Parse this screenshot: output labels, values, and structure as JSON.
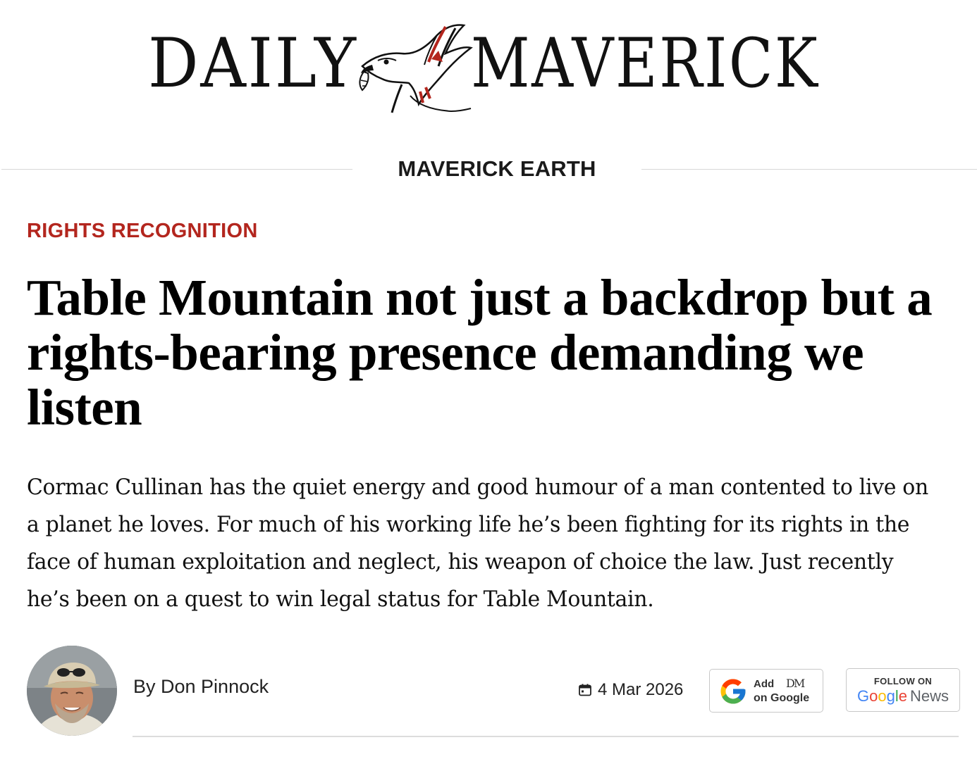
{
  "masthead": {
    "logo_left": "DAILY",
    "logo_right": "MAVERICK",
    "logo_icon": "eagle-icon"
  },
  "section": {
    "label": "MAVERICK EARTH"
  },
  "article": {
    "kicker": "RIGHTS RECOGNITION",
    "headline": "Table Mountain not just a backdrop but a rights-bearing presence demanding we listen",
    "standfirst": "Cormac Cullinan has the quiet energy and good humour of a man contented to live on a planet he loves. For much of his working life he’s been fighting for its rights in the face of human exploitation and neglect, his weapon of choice the law. Just recently he’s been on a quest to win legal status for Table Mountain."
  },
  "byline": {
    "author": "By Don Pinnock",
    "date": "4 Mar 2026",
    "date_icon": "calendar-icon"
  },
  "buttons": {
    "add_google": {
      "line1": "Add",
      "mark": "DM",
      "line2": "on Google"
    },
    "google_news": {
      "follow": "FOLLOW ON",
      "g1": "G",
      "g2": "o",
      "g3": "o",
      "g4": "g",
      "g5": "l",
      "g6": "e",
      "news": "News"
    }
  },
  "colors": {
    "kicker": "#b3261e",
    "text": "#111111",
    "rule": "#d8d8d8"
  }
}
